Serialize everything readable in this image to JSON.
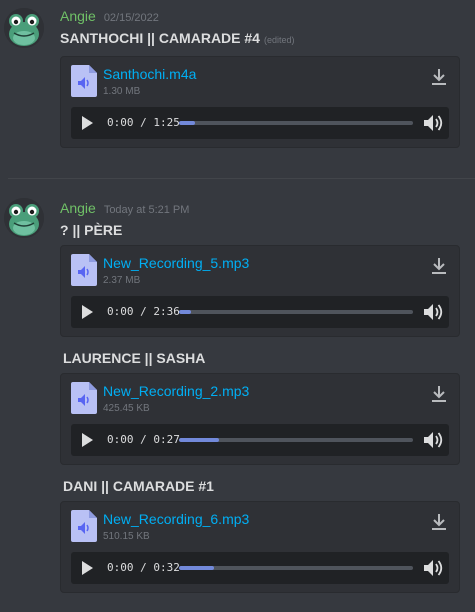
{
  "messages": [
    {
      "username": "Angie",
      "timestamp": "02/15/2022",
      "groups": [
        {
          "title": "SANTHOCHI || CAMARADE #4",
          "edited": "(edited)",
          "file": {
            "name": "Santhochi.m4a",
            "size": "1.30 MB",
            "time": "0:00 / 1:25",
            "progress": 0.07
          }
        }
      ]
    },
    {
      "username": "Angie",
      "timestamp": "Today at 5:21 PM",
      "groups": [
        {
          "title": "? || PÈRE",
          "file": {
            "name": "New_Recording_5.mp3",
            "size": "2.37 MB",
            "time": "0:00 / 2:36",
            "progress": 0.05
          }
        },
        {
          "title": "LAURENCE || SASHA",
          "file": {
            "name": "New_Recording_2.mp3",
            "size": "425.45 KB",
            "time": "0:00 / 0:27",
            "progress": 0.17
          }
        },
        {
          "title": "DANI || CAMARADE #1",
          "file": {
            "name": "New_Recording_6.mp3",
            "size": "510.15 KB",
            "time": "0:00 / 0:32",
            "progress": 0.15
          }
        }
      ]
    }
  ],
  "colors": {
    "background": "#36393f",
    "attachment_bg": "#2f3136",
    "player_bg": "#202225",
    "username": "#70c167",
    "link": "#00aff4",
    "progress": "#7289da"
  },
  "icons": {
    "avatar": "frog-avatar",
    "file": "audio-file-icon",
    "download": "download-icon",
    "play": "play-icon",
    "volume": "volume-icon"
  }
}
